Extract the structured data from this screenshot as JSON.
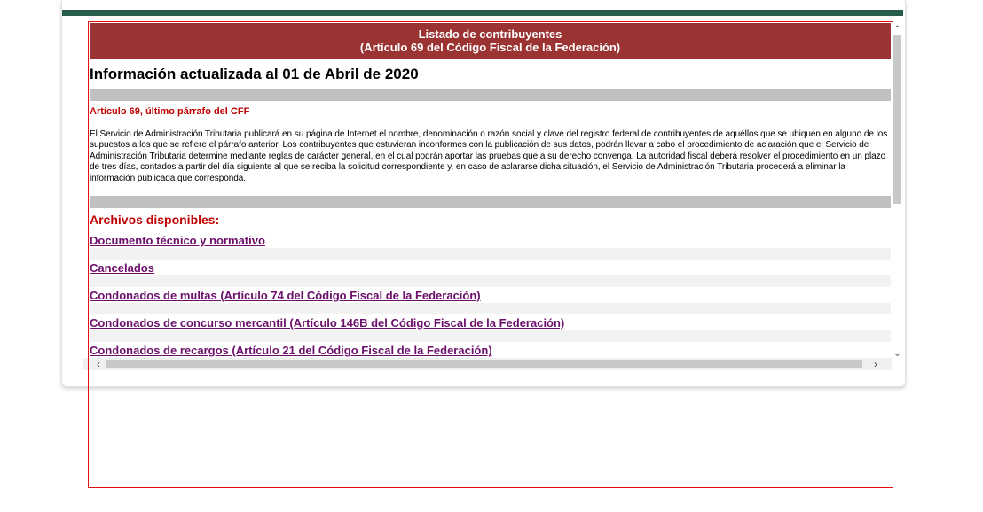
{
  "header": {
    "line1": "Listado de contribuyentes",
    "line2": "(Artículo 69 del Código Fiscal de la Federación)"
  },
  "info_title": "Información actualizada al 01 de Abril de 2020",
  "article_title": "Artículo 69, último párrafo del CFF",
  "article_text": "El Servicio de Administración Tributaria publicará en su página de Internet el nombre, denominación o razón social y clave del registro federal de contribuyentes de aquéllos que se ubiquen en alguno de los supuestos a los que se refiere el párrafo anterior. Los contribuyentes que estuvieran inconformes con la publicación de sus datos, podrán llevar a cabo el procedimiento de aclaración que el Servicio de Administración Tributaria determine mediante reglas de carácter general, en el cual podrán aportar las pruebas que a su derecho convenga. La autoridad fiscal deberá resolver el procedimiento en un plazo de tres días, contados a partir del día siguiente al que se reciba la solicitud correspondiente y, en caso de aclararse dicha situación, el Servicio de Administración Tributaria procederá a eliminar la información publicada que corresponda.",
  "archives_title": "Archivos disponibles:",
  "links": [
    "Documento técnico y normativo",
    "Cancelados",
    "Condonados de multas (Artículo 74 del Código Fiscal de la Federación)",
    "Condonados de concurso mercantil (Artículo 146B del Código Fiscal de la Federación)",
    "Condonados de recargos (Artículo 21 del Código Fiscal de la Federación)"
  ],
  "colors": {
    "header_bg": "#9b3333",
    "top_bar": "#285c4d",
    "link": "#6b0f6b",
    "accent_red": "#c00000"
  },
  "icons": {
    "scroll_up": "chevron-up-icon",
    "scroll_down": "chevron-down-icon",
    "scroll_left": "chevron-left-icon",
    "scroll_right": "chevron-right-icon"
  }
}
